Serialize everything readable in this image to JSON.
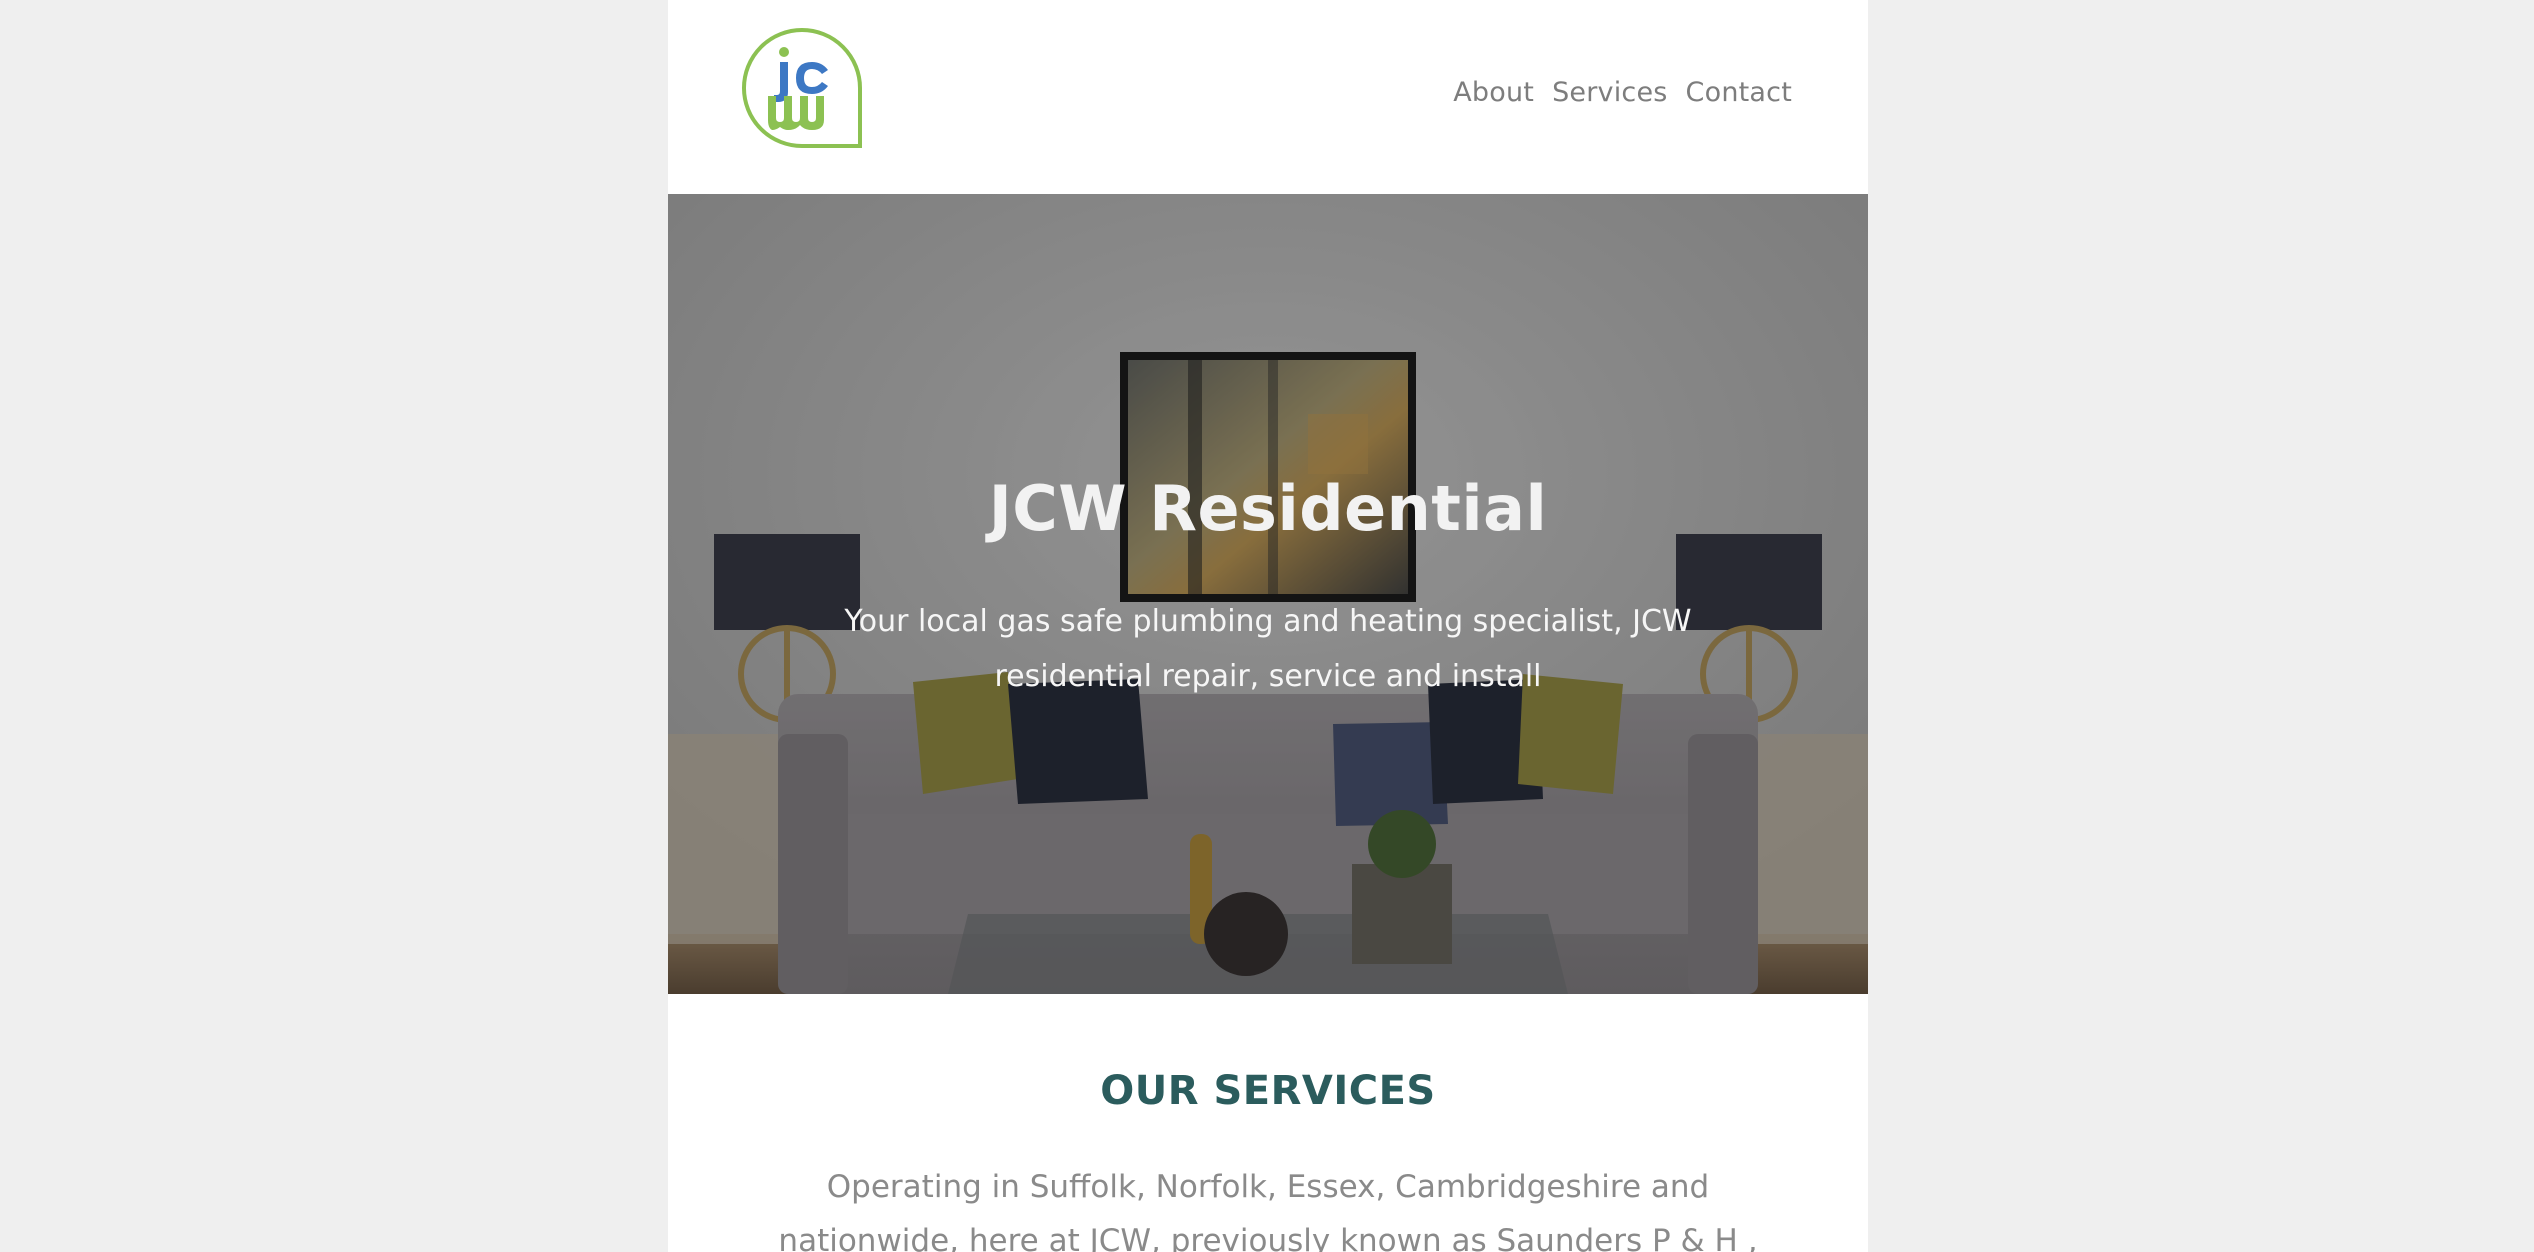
{
  "header": {
    "logo_text": "jcw",
    "nav": [
      {
        "label": "About"
      },
      {
        "label": "Services"
      },
      {
        "label": "Contact"
      }
    ]
  },
  "hero": {
    "title": "JCW Residential",
    "subtitle": "Your local gas safe plumbing and heating specialist, JCW residential repair, service and install"
  },
  "services": {
    "heading": "OUR SERVICES",
    "intro": "Operating in Suffolk, Norfolk, Essex, Cambridgeshire and nationwide, here at JCW, previously known as Saunders P & H ,"
  },
  "colors": {
    "logo_green": "#8cc152",
    "logo_blue": "#3d78c4",
    "heading_teal": "#2b5c5d",
    "nav_grey": "#7d7d7d",
    "page_bg": "#efefef"
  }
}
